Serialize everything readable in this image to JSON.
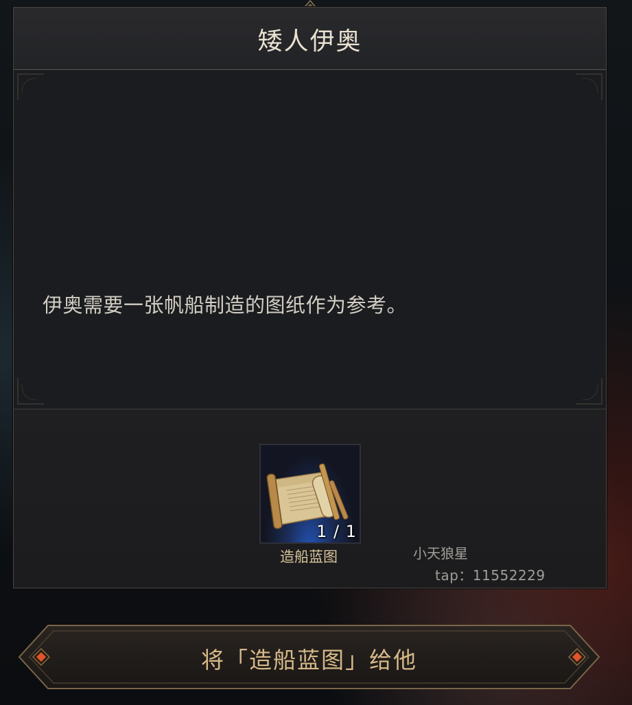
{
  "dialog": {
    "title": "矮人伊奥",
    "message": "伊奥需要一张帆船制造的图纸作为参考。"
  },
  "item": {
    "name": "造船蓝图",
    "count": "1 / 1",
    "icon": "scroll-blueprint-icon"
  },
  "watermark": {
    "line1": "小天狼星",
    "line2": "tap：11552229"
  },
  "action": {
    "give_label": "将「造船蓝图」给他"
  },
  "colors": {
    "accent": "#d6b989",
    "button_gem": "#e0552a",
    "slot_glow": "#2455b8"
  }
}
